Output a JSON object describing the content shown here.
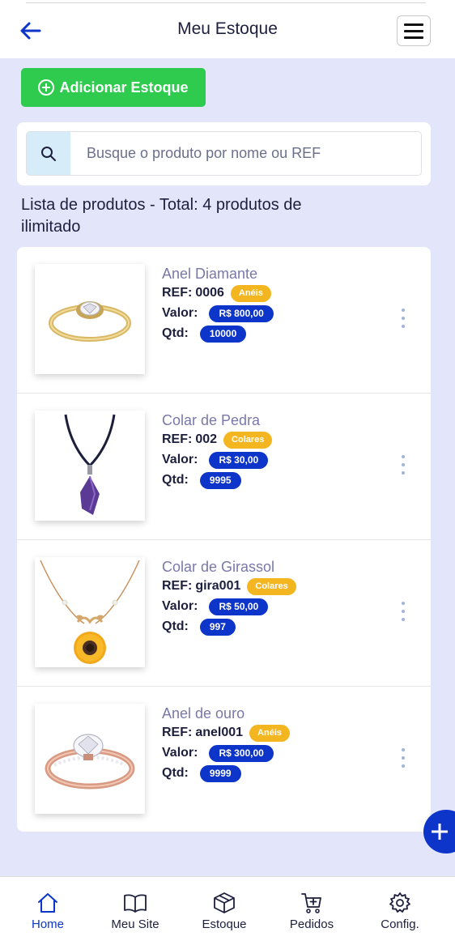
{
  "header": {
    "title": "Meu Estoque"
  },
  "actions": {
    "add_stock_label": "Adicionar Estoque"
  },
  "search": {
    "placeholder": "Busque o produto por nome ou REF"
  },
  "list": {
    "title": "Lista de produtos - Total: 4 produtos de ilimitado"
  },
  "labels": {
    "ref": "REF:",
    "valor": "Valor:",
    "qtd": "Qtd:"
  },
  "products": [
    {
      "name": "Anel Diamante",
      "ref": "0006",
      "category": "Anéis",
      "price": "R$ 800,00",
      "qty": "10000",
      "image": "ring-diamond"
    },
    {
      "name": "Colar de Pedra",
      "ref": "002",
      "category": "Colares",
      "price": "R$ 30,00",
      "qty": "9995",
      "image": "necklace-stone"
    },
    {
      "name": "Colar de Girassol",
      "ref": "gira001",
      "category": "Colares",
      "price": "R$ 50,00",
      "qty": "997",
      "image": "necklace-sunflower"
    },
    {
      "name": "Anel de ouro",
      "ref": "anel001",
      "category": "Anéis",
      "price": "R$ 300,00",
      "qty": "9999",
      "image": "ring-gold"
    }
  ],
  "bottom_nav": [
    {
      "label": "Home",
      "icon": "home-icon",
      "active": true
    },
    {
      "label": "Meu Site",
      "icon": "book-icon",
      "active": false
    },
    {
      "label": "Estoque",
      "icon": "box-icon",
      "active": false
    },
    {
      "label": "Pedidos",
      "icon": "cart-icon",
      "active": false
    },
    {
      "label": "Config.",
      "icon": "gear-icon",
      "active": false
    }
  ],
  "colors": {
    "background": "#e3e5fb",
    "primary": "#0d35c9",
    "success": "#2ecb4f",
    "category_badge": "#f4b620",
    "product_name": "#7a78a8"
  }
}
